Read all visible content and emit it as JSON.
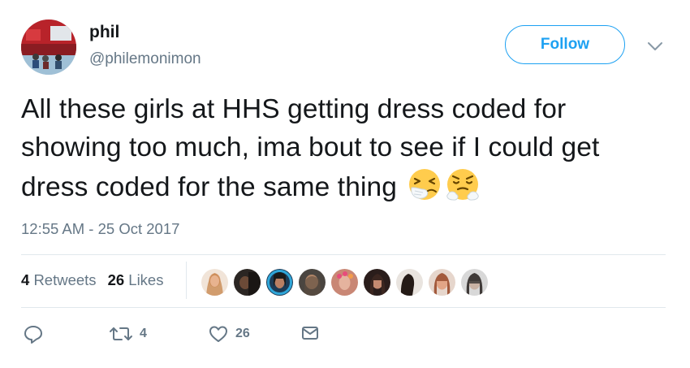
{
  "author": {
    "display_name": "phil",
    "handle": "@philemonimon",
    "avatar_icon": "profile-photo"
  },
  "follow_button": {
    "label": "Follow",
    "color": "#1da1f2"
  },
  "menu_caret_icon": "chevron-down-icon",
  "tweet": {
    "text": "All these girls at HHS getting dress coded for showing too much, ima bout to see if I could get dress coded for the same thing",
    "emojis": [
      "sneezing-face-emoji",
      "face-with-steam-from-nose-emoji"
    ],
    "timestamp": "12:55 AM - 25 Oct 2017"
  },
  "stats": {
    "retweets_count": "4",
    "retweets_label": "Retweets",
    "likes_count": "26",
    "likes_label": "Likes",
    "liker_avatars": [
      "liker-1",
      "liker-2",
      "liker-3",
      "liker-4",
      "liker-5",
      "liker-6",
      "liker-7",
      "liker-8",
      "liker-9"
    ]
  },
  "actions": {
    "reply_icon": "reply-icon",
    "retweet_icon": "retweet-icon",
    "retweet_count": "4",
    "like_icon": "heart-icon",
    "like_count": "26",
    "dm_icon": "envelope-icon"
  }
}
